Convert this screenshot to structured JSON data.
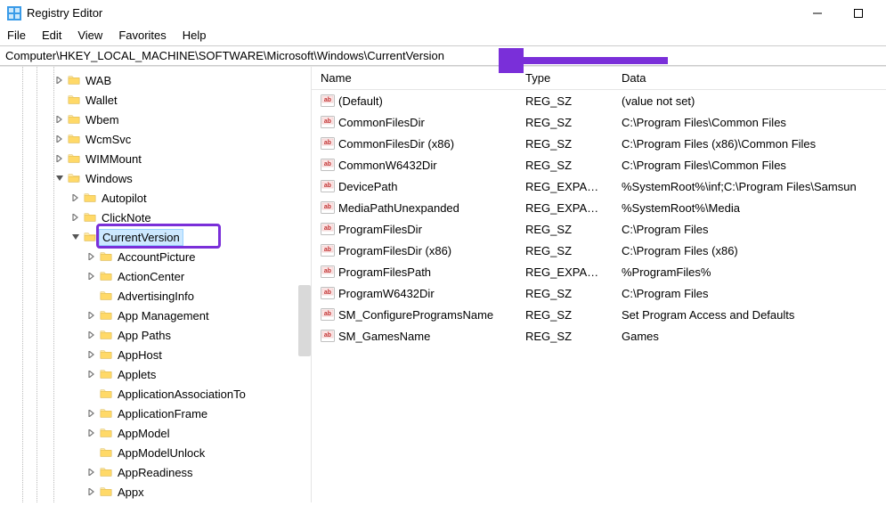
{
  "window": {
    "title": "Registry Editor"
  },
  "menu": {
    "file": "File",
    "edit": "Edit",
    "view": "View",
    "favorites": "Favorites",
    "help": "Help"
  },
  "address": "Computer\\HKEY_LOCAL_MACHINE\\SOFTWARE\\Microsoft\\Windows\\CurrentVersion",
  "tree": [
    {
      "indent": 3,
      "chev": "right",
      "label": "WAB"
    },
    {
      "indent": 3,
      "chev": "none",
      "label": "Wallet"
    },
    {
      "indent": 3,
      "chev": "right",
      "label": "Wbem"
    },
    {
      "indent": 3,
      "chev": "right",
      "label": "WcmSvc"
    },
    {
      "indent": 3,
      "chev": "right",
      "label": "WIMMount"
    },
    {
      "indent": 3,
      "chev": "down",
      "label": "Windows"
    },
    {
      "indent": 4,
      "chev": "right",
      "label": "Autopilot"
    },
    {
      "indent": 4,
      "chev": "right",
      "label": "ClickNote"
    },
    {
      "indent": 4,
      "chev": "down",
      "label": "CurrentVersion",
      "selected": true
    },
    {
      "indent": 5,
      "chev": "right",
      "label": "AccountPicture"
    },
    {
      "indent": 5,
      "chev": "right",
      "label": "ActionCenter"
    },
    {
      "indent": 5,
      "chev": "none",
      "label": "AdvertisingInfo"
    },
    {
      "indent": 5,
      "chev": "right",
      "label": "App Management"
    },
    {
      "indent": 5,
      "chev": "right",
      "label": "App Paths"
    },
    {
      "indent": 5,
      "chev": "right",
      "label": "AppHost"
    },
    {
      "indent": 5,
      "chev": "right",
      "label": "Applets"
    },
    {
      "indent": 5,
      "chev": "none",
      "label": "ApplicationAssociationTo"
    },
    {
      "indent": 5,
      "chev": "right",
      "label": "ApplicationFrame"
    },
    {
      "indent": 5,
      "chev": "right",
      "label": "AppModel"
    },
    {
      "indent": 5,
      "chev": "none",
      "label": "AppModelUnlock"
    },
    {
      "indent": 5,
      "chev": "right",
      "label": "AppReadiness"
    },
    {
      "indent": 5,
      "chev": "right",
      "label": "Appx"
    }
  ],
  "columns": {
    "name": "Name",
    "type": "Type",
    "data": "Data"
  },
  "values": [
    {
      "name": "(Default)",
      "type": "REG_SZ",
      "data": "(value not set)"
    },
    {
      "name": "CommonFilesDir",
      "type": "REG_SZ",
      "data": "C:\\Program Files\\Common Files"
    },
    {
      "name": "CommonFilesDir (x86)",
      "type": "REG_SZ",
      "data": "C:\\Program Files (x86)\\Common Files"
    },
    {
      "name": "CommonW6432Dir",
      "type": "REG_SZ",
      "data": "C:\\Program Files\\Common Files"
    },
    {
      "name": "DevicePath",
      "type": "REG_EXPAN...",
      "data": "%SystemRoot%\\inf;C:\\Program Files\\Samsun"
    },
    {
      "name": "MediaPathUnexpanded",
      "type": "REG_EXPAN...",
      "data": "%SystemRoot%\\Media"
    },
    {
      "name": "ProgramFilesDir",
      "type": "REG_SZ",
      "data": "C:\\Program Files"
    },
    {
      "name": "ProgramFilesDir (x86)",
      "type": "REG_SZ",
      "data": "C:\\Program Files (x86)"
    },
    {
      "name": "ProgramFilesPath",
      "type": "REG_EXPAN...",
      "data": "%ProgramFiles%"
    },
    {
      "name": "ProgramW6432Dir",
      "type": "REG_SZ",
      "data": "C:\\Program Files"
    },
    {
      "name": "SM_ConfigureProgramsName",
      "type": "REG_SZ",
      "data": "Set Program Access and Defaults"
    },
    {
      "name": "SM_GamesName",
      "type": "REG_SZ",
      "data": "Games"
    }
  ],
  "annotation": {
    "color": "#7a2fd9"
  }
}
